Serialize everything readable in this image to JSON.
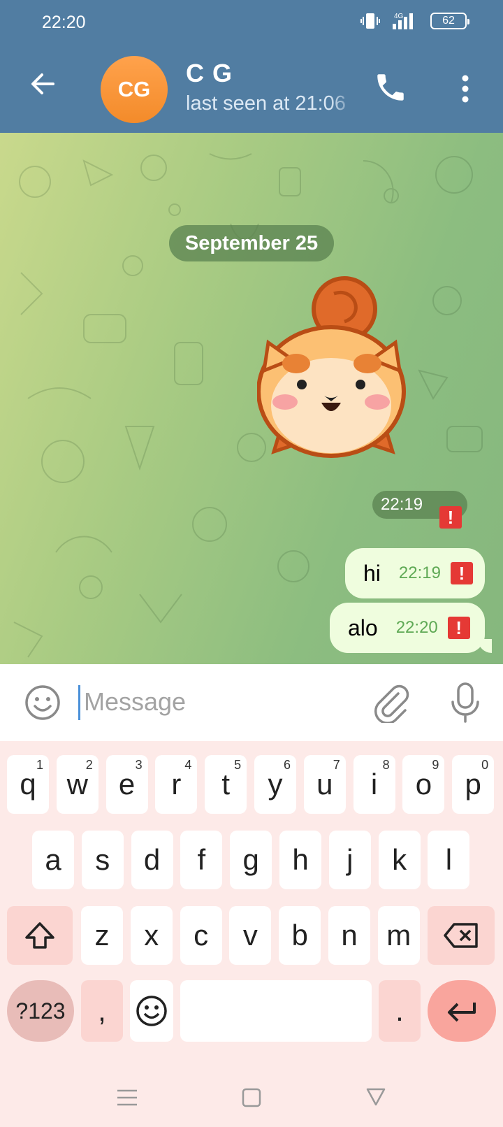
{
  "status": {
    "time": "22:20",
    "network": "4G",
    "battery": "62"
  },
  "header": {
    "avatar_initials": "CG",
    "name": "C G",
    "last_seen": "last seen at 21:06"
  },
  "chat": {
    "date": "September 25",
    "sticker_time": "22:19",
    "messages": [
      {
        "text": "hi",
        "time": "22:19",
        "status": "!"
      },
      {
        "text": "alo",
        "time": "22:20",
        "status": "!"
      }
    ]
  },
  "composer": {
    "placeholder": "Message"
  },
  "keyboard": {
    "row1": [
      {
        "k": "q",
        "n": "1"
      },
      {
        "k": "w",
        "n": "2"
      },
      {
        "k": "e",
        "n": "3"
      },
      {
        "k": "r",
        "n": "4"
      },
      {
        "k": "t",
        "n": "5"
      },
      {
        "k": "y",
        "n": "6"
      },
      {
        "k": "u",
        "n": "7"
      },
      {
        "k": "i",
        "n": "8"
      },
      {
        "k": "o",
        "n": "9"
      },
      {
        "k": "p",
        "n": "0"
      }
    ],
    "row2": [
      "a",
      "s",
      "d",
      "f",
      "g",
      "h",
      "j",
      "k",
      "l"
    ],
    "row3": [
      "z",
      "x",
      "c",
      "v",
      "b",
      "n",
      "m"
    ],
    "sym_label": "?123",
    "comma": ",",
    "period": "."
  },
  "colors": {
    "header": "#517da2",
    "bubble": "#effdde",
    "error": "#e53935",
    "avatar": "#f7953a"
  }
}
